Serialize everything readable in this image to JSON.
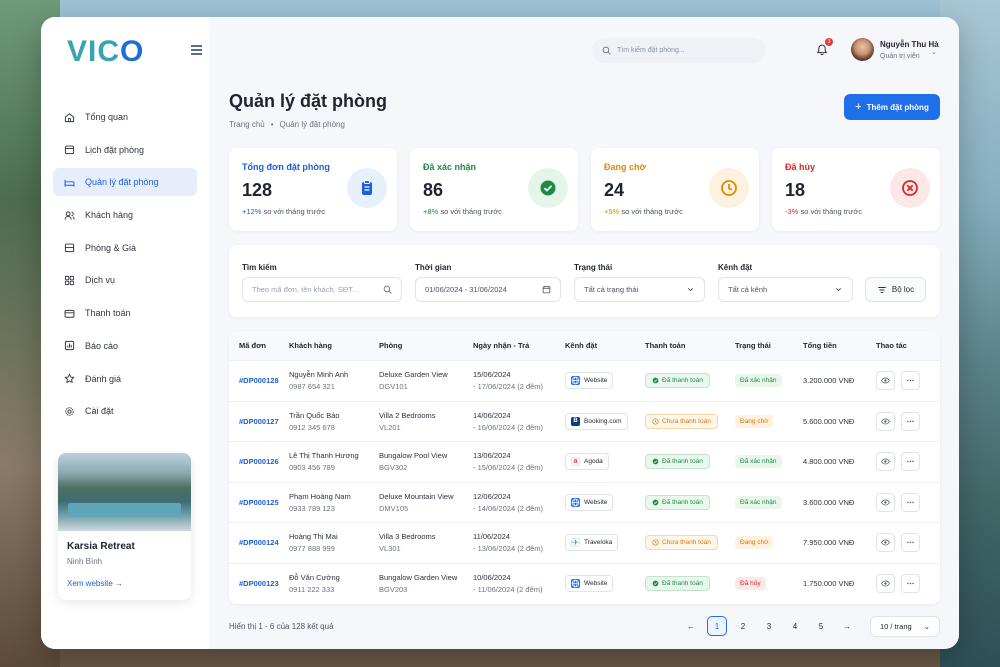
{
  "brand": {
    "logo_text_a": "VIC",
    "logo_text_b": "O"
  },
  "sidebar": {
    "items": [
      {
        "label": "Tổng quan",
        "icon": "home-icon"
      },
      {
        "label": "Lịch đặt phòng",
        "icon": "calendar-icon"
      },
      {
        "label": "Quản lý đặt phòng",
        "icon": "bed-icon",
        "active": true
      },
      {
        "label": "Khách hàng",
        "icon": "users-icon"
      },
      {
        "label": "Phòng & Giá",
        "icon": "room-icon"
      },
      {
        "label": "Dịch vụ",
        "icon": "service-icon"
      },
      {
        "label": "Thanh toán",
        "icon": "wallet-icon"
      },
      {
        "label": "Báo cáo",
        "icon": "report-icon"
      },
      {
        "label": "Đánh giá",
        "icon": "star-icon"
      },
      {
        "label": "Cài đặt",
        "icon": "gear-icon"
      }
    ],
    "promo": {
      "title": "Karsia Retreat",
      "location": "Ninh Bình",
      "link": "Xem website",
      "link_arrow": "→"
    }
  },
  "topbar": {
    "search_placeholder": "Tìm kiếm đặt phòng...",
    "notification_count": "3",
    "user_name": "Nguyễn Thu Hà",
    "user_role": "Quản trị viên"
  },
  "header": {
    "title": "Quản lý đặt phòng",
    "breadcrumb_home": "Trang chủ",
    "breadcrumb_sep": "•",
    "breadcrumb_current": "Quản lý đặt phòng",
    "add_button": "Thêm đặt phòng",
    "add_plus": "+"
  },
  "stats": [
    {
      "label": "Tổng đơn đặt phòng",
      "value": "128",
      "delta": "+12%",
      "note": "so với tháng trước",
      "color": "#1d5fd6",
      "bg": "#e7f0fd",
      "icon": "clipboard-icon"
    },
    {
      "label": "Đã xác nhận",
      "value": "86",
      "delta": "+8%",
      "note": "so với tháng trước",
      "color": "#1f8a46",
      "bg": "#e6f5ea",
      "icon": "check-circle-icon"
    },
    {
      "label": "Đang chờ",
      "value": "24",
      "delta": "+5%",
      "note": "so với tháng trước",
      "color": "#e08a00",
      "bg": "#fdf1df",
      "icon": "clock-icon"
    },
    {
      "label": "Đã hủy",
      "value": "18",
      "delta": "-3%",
      "note": "so với tháng trước",
      "color": "#dc2626",
      "bg": "#fde8e8",
      "icon": "x-circle-icon"
    }
  ],
  "filters": {
    "search_label": "Tìm kiếm",
    "search_placeholder": "Theo mã đơn, tên khách, SĐT...",
    "date_label": "Thời gian",
    "date_value": "01/06/2024 - 31/06/2024",
    "status_label": "Trạng thái",
    "status_value": "Tất cả trạng thái",
    "channel_label": "Kênh đặt",
    "channel_value": "Tất cả kênh",
    "filter_button": "Bộ lọc"
  },
  "table": {
    "headers": [
      "Mã đơn",
      "Khách hàng",
      "Phòng",
      "Ngày nhận - Trả",
      "Kênh đặt",
      "Thanh toán",
      "Trạng thái",
      "Tổng tiền",
      "Thao tác"
    ],
    "rows": [
      {
        "id": "#DP000128",
        "name": "Nguyễn Minh Anh",
        "phone": "0987 654 321",
        "room": "Deluxe Garden View",
        "room_code": "DGV101",
        "checkin": "15/06/2024",
        "checkout": "- 17/06/2024 (2 đêm)",
        "channel": "Website",
        "channel_icon": "globe-icon",
        "payment": "Đã thanh toán",
        "payment_ok": true,
        "status": "Đã xác nhận",
        "status_type": "green",
        "total": "3.200.000 VNĐ"
      },
      {
        "id": "#DP000127",
        "name": "Trần Quốc Bảo",
        "phone": "0912 345 678",
        "room": "Villa 2 Bedrooms",
        "room_code": "VL201",
        "checkin": "14/06/2024",
        "checkout": "- 16/06/2024 (2 đêm)",
        "channel": "Booking.com",
        "channel_icon": "booking-icon",
        "payment": "Chưa thanh toán",
        "payment_ok": false,
        "status": "Đang chờ",
        "status_type": "orange",
        "total": "5.600.000 VNĐ"
      },
      {
        "id": "#DP000126",
        "name": "Lê Thị Thanh Hương",
        "phone": "0903 456 789",
        "room": "Bungalow Pool View",
        "room_code": "BGV302",
        "checkin": "13/06/2024",
        "checkout": "- 15/06/2024 (2 đêm)",
        "channel": "Agoda",
        "channel_icon": "agoda-icon",
        "payment": "Đã thanh toán",
        "payment_ok": true,
        "status": "Đã xác nhận",
        "status_type": "green",
        "total": "4.800.000 VNĐ"
      },
      {
        "id": "#DP000125",
        "name": "Phạm Hoàng Nam",
        "phone": "0933 789 123",
        "room": "Deluxe Mountain View",
        "room_code": "DMV105",
        "checkin": "12/06/2024",
        "checkout": "- 14/06/2024 (2 đêm)",
        "channel": "Website",
        "channel_icon": "globe-icon",
        "payment": "Đã thanh toán",
        "payment_ok": true,
        "status": "Đã xác nhận",
        "status_type": "green",
        "total": "3.600.000 VNĐ"
      },
      {
        "id": "#DP000124",
        "name": "Hoàng Thị Mai",
        "phone": "0977 888 999",
        "room": "Villa 3 Bedrooms",
        "room_code": "VL301",
        "checkin": "11/06/2024",
        "checkout": "- 13/06/2024 (2 đêm)",
        "channel": "Traveloka",
        "channel_icon": "traveloka-icon",
        "payment": "Chưa thanh toán",
        "payment_ok": false,
        "status": "Đang chờ",
        "status_type": "orange",
        "total": "7.950.000 VNĐ"
      },
      {
        "id": "#DP000123",
        "name": "Đỗ Văn Cường",
        "phone": "0911 222 333",
        "room": "Bungalow Garden View",
        "room_code": "BGV203",
        "checkin": "10/06/2024",
        "checkout": "- 11/06/2024 (2 đêm)",
        "channel": "Website",
        "channel_icon": "globe-icon",
        "payment": "Đã thanh toán",
        "payment_ok": true,
        "status": "Đã hủy",
        "status_type": "red",
        "total": "1.750.000 VNĐ"
      }
    ]
  },
  "pagination": {
    "showing": "Hiển thị 1 - 6 của 128 kết quả",
    "prev": "←",
    "next": "→",
    "pages": [
      "1",
      "2",
      "3",
      "4",
      "5"
    ],
    "current": "1",
    "per_page": "10 / trang"
  }
}
